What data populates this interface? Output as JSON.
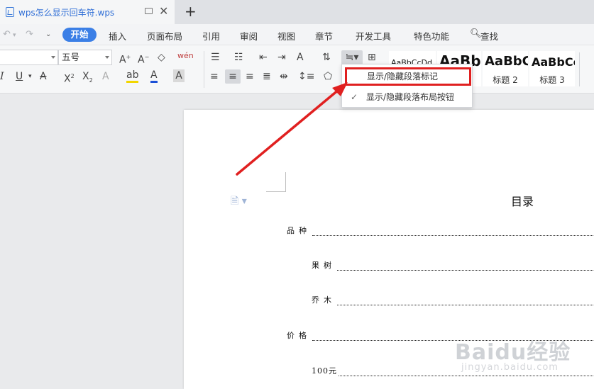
{
  "tab": {
    "title": "wps怎么显示回车符.wps"
  },
  "menu": {
    "start": "开始",
    "items": [
      "插入",
      "页面布局",
      "引用",
      "审阅",
      "视图",
      "章节",
      "开发工具",
      "特色功能",
      "查找"
    ]
  },
  "ribbon": {
    "font_size": "五号",
    "style_samples": [
      "AaBbCcDd",
      "AaBb",
      "AaBbC",
      "AaBbCc"
    ],
    "style_labels": [
      "标题 2",
      "标题 3"
    ]
  },
  "popup": {
    "items": [
      {
        "label": "显示/隐藏段落标记",
        "checked": false,
        "highlighted": true
      },
      {
        "label": "显示/隐藏段落布局按钮",
        "checked": true,
        "highlighted": false
      }
    ]
  },
  "document": {
    "toc_title": "目录",
    "entries": [
      "品种",
      "果树",
      "乔木",
      "价格",
      "100元"
    ]
  },
  "colors": {
    "accent": "#3b7fe6",
    "highlight_border": "#e02020",
    "arrow": "#e02020"
  },
  "watermark": {
    "main": "Baidu经验",
    "sub": "jingyan.baidu.com"
  }
}
